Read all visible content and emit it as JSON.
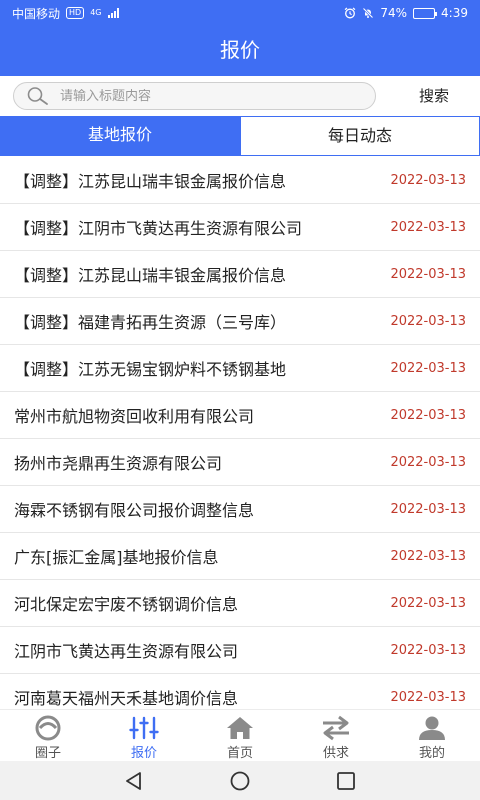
{
  "status_bar": {
    "carrier": "中国移动",
    "network_badge": "HD",
    "network_type": "4G",
    "battery_percent": "74%",
    "battery_level": 0.74,
    "time": "4:39"
  },
  "header": {
    "title": "报价"
  },
  "search": {
    "placeholder": "请输入标题内容",
    "value": "",
    "button_label": "搜索"
  },
  "tabs": [
    {
      "label": "基地报价",
      "active": true
    },
    {
      "label": "每日动态",
      "active": false
    }
  ],
  "list": [
    {
      "title": "【调整】江苏昆山瑞丰银金属报价信息",
      "date": "2022-03-13"
    },
    {
      "title": "【调整】江阴市飞黄达再生资源有限公司",
      "date": "2022-03-13"
    },
    {
      "title": "【调整】江苏昆山瑞丰银金属报价信息",
      "date": "2022-03-13"
    },
    {
      "title": "【调整】福建青拓再生资源（三号库）",
      "date": "2022-03-13"
    },
    {
      "title": "【调整】江苏无锡宝钢炉料不锈钢基地",
      "date": "2022-03-13"
    },
    {
      "title": "常州市航旭物资回收利用有限公司",
      "date": "2022-03-13"
    },
    {
      "title": "扬州市尧鼎再生资源有限公司",
      "date": "2022-03-13"
    },
    {
      "title": "海霖不锈钢有限公司报价调整信息",
      "date": "2022-03-13"
    },
    {
      "title": "广东[振汇金属]基地报价信息",
      "date": "2022-03-13"
    },
    {
      "title": "河北保定宏宇废不锈钢调价信息",
      "date": "2022-03-13"
    },
    {
      "title": "江阴市飞黄达再生资源有限公司",
      "date": "2022-03-13"
    },
    {
      "title": "河南葛天福州天禾基地调价信息",
      "date": "2022-03-13"
    }
  ],
  "bottom_nav": [
    {
      "label": "圈子",
      "icon": "circle-icon",
      "active": false
    },
    {
      "label": "报价",
      "icon": "sliders-icon",
      "active": true
    },
    {
      "label": "首页",
      "icon": "home-icon",
      "active": false
    },
    {
      "label": "供求",
      "icon": "exchange-icon",
      "active": false
    },
    {
      "label": "我的",
      "icon": "user-icon",
      "active": false
    }
  ],
  "colors": {
    "brand": "#3f6ef3",
    "date": "#c0392b",
    "inactive_icon": "#8a8a8a"
  }
}
